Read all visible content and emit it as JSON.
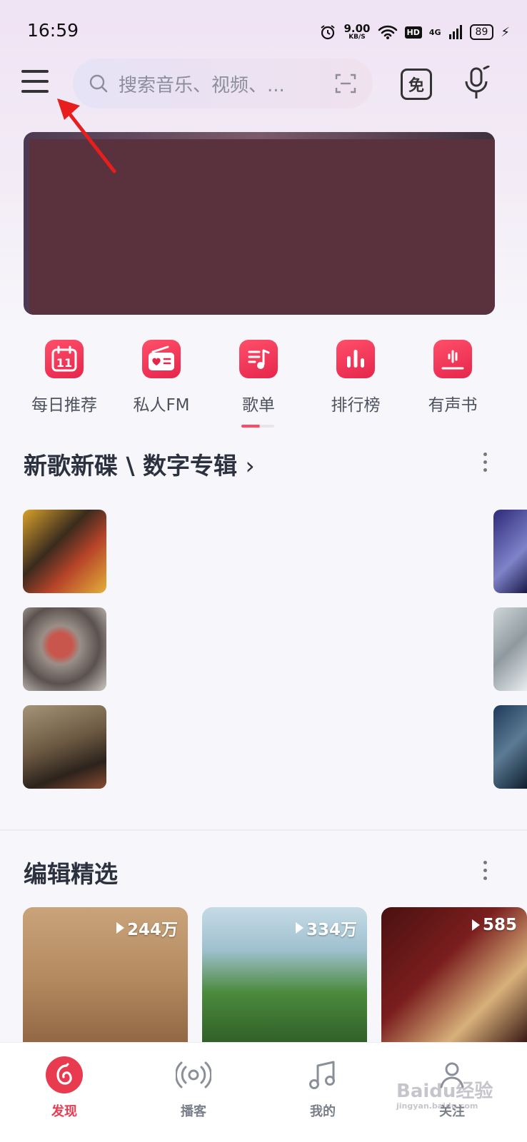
{
  "status_bar": {
    "time": "16:59",
    "speed_value": "9.00",
    "speed_unit": "KB/S",
    "hd": "HD",
    "network": "4G",
    "battery": "89"
  },
  "header": {
    "search_placeholder": "搜索音乐、视频、...",
    "free_label": "免"
  },
  "quick_entries": [
    {
      "label": "每日推荐",
      "icon": "calendar-icon",
      "day": "11"
    },
    {
      "label": "私人FM",
      "icon": "radio-heart-icon"
    },
    {
      "label": "歌单",
      "icon": "playlist-note-icon"
    },
    {
      "label": "排行榜",
      "icon": "bar-chart-icon"
    },
    {
      "label": "有声书",
      "icon": "audiobook-icon"
    }
  ],
  "sections": {
    "new_releases": {
      "title": "新歌新碟 \\ 数字专辑"
    },
    "editor_picks": {
      "title": "编辑精选"
    }
  },
  "editor_picks": [
    {
      "plays": "244万"
    },
    {
      "plays": "334万"
    },
    {
      "plays": "585"
    }
  ],
  "bottom_nav": [
    {
      "label": "发现",
      "icon": "discover-icon",
      "active": true
    },
    {
      "label": "播客",
      "icon": "podcast-icon",
      "active": false
    },
    {
      "label": "我的",
      "icon": "music-note-icon",
      "active": false
    },
    {
      "label": "关注",
      "icon": "follow-user-icon",
      "active": false
    }
  ],
  "watermark": {
    "main": "Baidu经验",
    "sub": "jingyan.baidu.com"
  },
  "colors": {
    "accent": "#e93b4f",
    "icon_red": "#f0304e",
    "text_dark": "#2c3140"
  }
}
